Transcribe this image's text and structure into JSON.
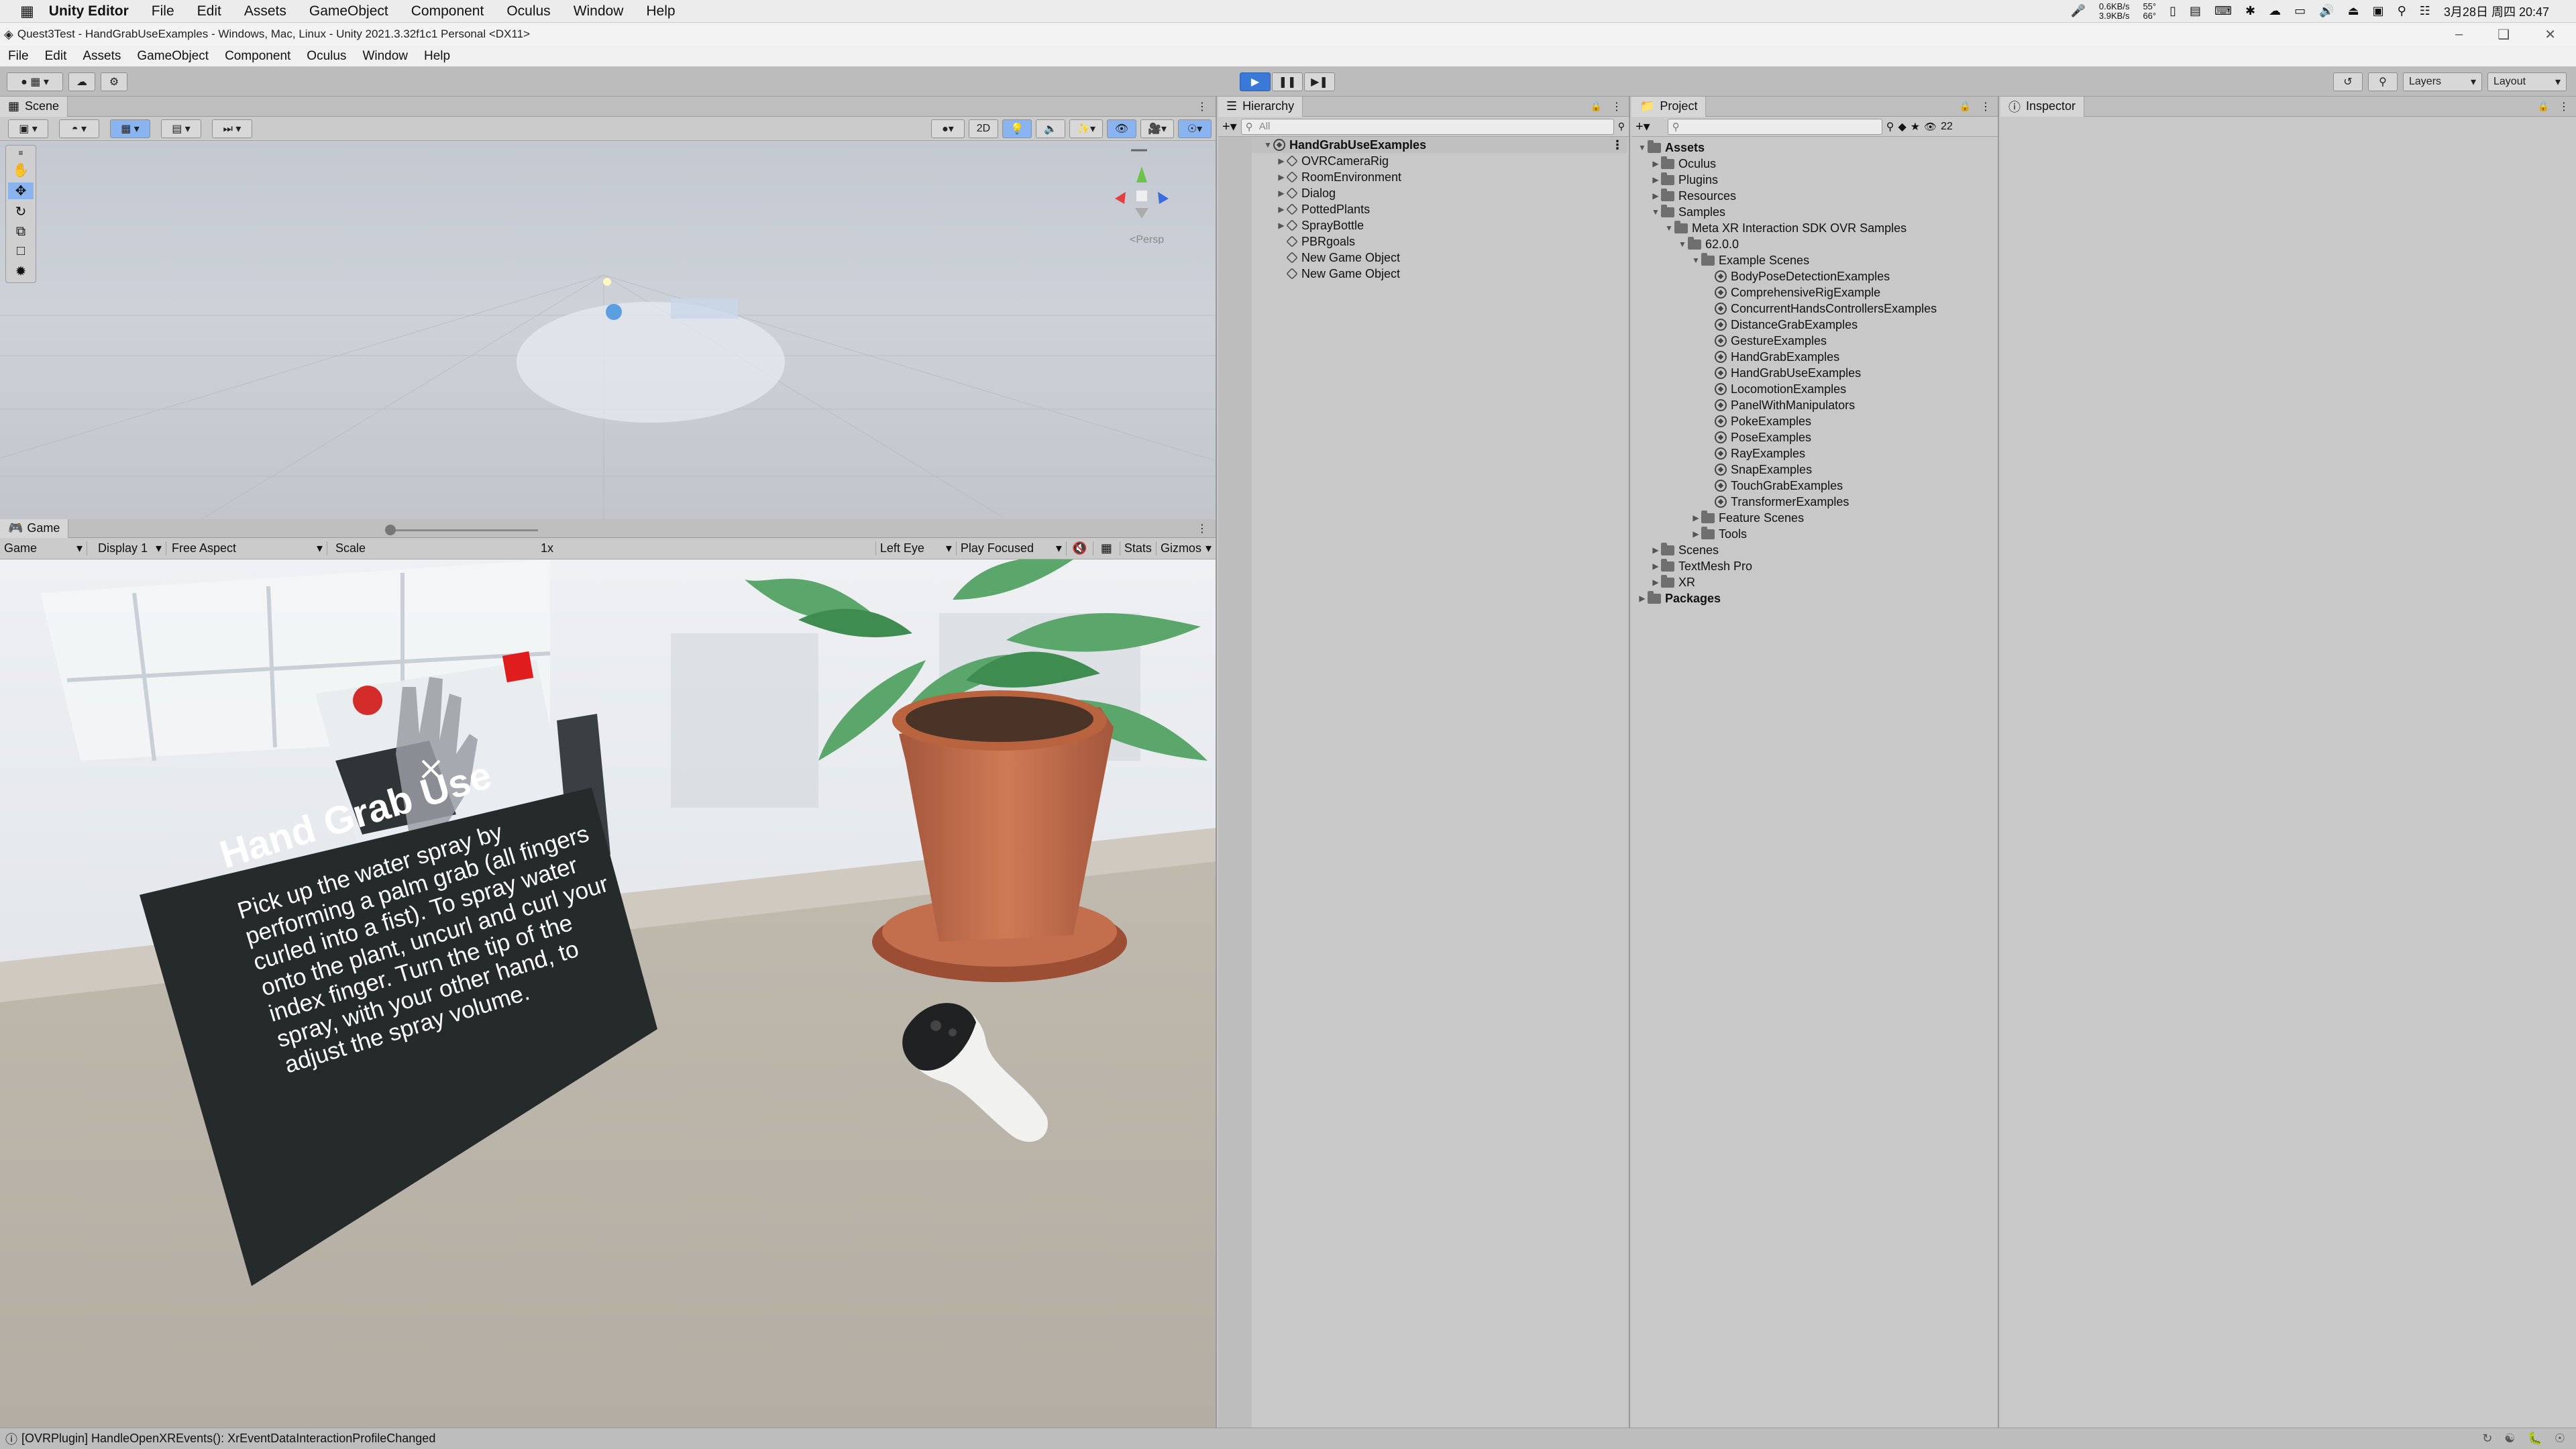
{
  "os_menu": {
    "app": "Unity Editor",
    "items": [
      "File",
      "Edit",
      "Assets",
      "GameObject",
      "Component",
      "Oculus",
      "Window",
      "Help"
    ],
    "net_up": "0.6KB/s",
    "net_down": "3.9KB/s",
    "temp1": "55°",
    "temp2": "66°",
    "clock": "3月28日 周四 20:47"
  },
  "window_title": "Quest3Test - HandGrabUseExamples - Windows, Mac, Linux - Unity 2021.3.32f1c1 Personal <DX11>",
  "menubar": [
    "File",
    "Edit",
    "Assets",
    "GameObject",
    "Component",
    "Oculus",
    "Window",
    "Help"
  ],
  "toolbar": {
    "layers_label": "Layers",
    "layout_label": "Layout"
  },
  "scene": {
    "tab": "Scene",
    "toggle_2d": "2D",
    "persp_label": "<Persp"
  },
  "game": {
    "tab": "Game",
    "view_select": "Game",
    "display_select": "Display 1",
    "aspect_select": "Free Aspect",
    "scale_label": "Scale",
    "scale_value": "1x",
    "eye_select": "Left Eye",
    "play_mode_select": "Play Focused",
    "stats_label": "Stats",
    "gizmos_label": "Gizmos",
    "panel_title": "Hand Grab Use",
    "panel_text": "Pick up the water spray by performing a palm grab (all fingers curled into a fist). To spray water onto the plant, uncurl and curl your index finger. Turn the tip of the spray, with your other hand, to adjust the spray volume."
  },
  "hierarchy": {
    "tab": "Hierarchy",
    "search_placeholder": "All",
    "root": "HandGrabUseExamples",
    "items": [
      {
        "label": "OVRCameraRig",
        "arrow": true
      },
      {
        "label": "RoomEnvironment",
        "arrow": true
      },
      {
        "label": "Dialog",
        "arrow": true
      },
      {
        "label": "PottedPlants",
        "arrow": true
      },
      {
        "label": "SprayBottle",
        "arrow": true
      },
      {
        "label": "PBRgoals",
        "arrow": false
      },
      {
        "label": "New Game Object",
        "arrow": false
      },
      {
        "label": "New Game Object",
        "arrow": false
      }
    ]
  },
  "project": {
    "tab": "Project",
    "hidden_count": "22",
    "tree": [
      {
        "label": "Assets",
        "level": 0,
        "arrow": "open",
        "icon": "folder",
        "bold": true
      },
      {
        "label": "Oculus",
        "level": 1,
        "arrow": "closed",
        "icon": "folder"
      },
      {
        "label": "Plugins",
        "level": 1,
        "arrow": "closed",
        "icon": "folder"
      },
      {
        "label": "Resources",
        "level": 1,
        "arrow": "closed",
        "icon": "folder"
      },
      {
        "label": "Samples",
        "level": 1,
        "arrow": "open",
        "icon": "folder"
      },
      {
        "label": "Meta XR Interaction SDK OVR Samples",
        "level": 2,
        "arrow": "open",
        "icon": "folder"
      },
      {
        "label": "62.0.0",
        "level": 3,
        "arrow": "open",
        "icon": "folder"
      },
      {
        "label": "Example Scenes",
        "level": 4,
        "arrow": "open",
        "icon": "folder"
      },
      {
        "label": "BodyPoseDetectionExamples",
        "level": 5,
        "arrow": "",
        "icon": "unity"
      },
      {
        "label": "ComprehensiveRigExample",
        "level": 5,
        "arrow": "",
        "icon": "unity"
      },
      {
        "label": "ConcurrentHandsControllersExamples",
        "level": 5,
        "arrow": "",
        "icon": "unity"
      },
      {
        "label": "DistanceGrabExamples",
        "level": 5,
        "arrow": "",
        "icon": "unity"
      },
      {
        "label": "GestureExamples",
        "level": 5,
        "arrow": "",
        "icon": "unity"
      },
      {
        "label": "HandGrabExamples",
        "level": 5,
        "arrow": "",
        "icon": "unity"
      },
      {
        "label": "HandGrabUseExamples",
        "level": 5,
        "arrow": "",
        "icon": "unity"
      },
      {
        "label": "LocomotionExamples",
        "level": 5,
        "arrow": "",
        "icon": "unity"
      },
      {
        "label": "PanelWithManipulators",
        "level": 5,
        "arrow": "",
        "icon": "unity"
      },
      {
        "label": "PokeExamples",
        "level": 5,
        "arrow": "",
        "icon": "unity"
      },
      {
        "label": "PoseExamples",
        "level": 5,
        "arrow": "",
        "icon": "unity"
      },
      {
        "label": "RayExamples",
        "level": 5,
        "arrow": "",
        "icon": "unity"
      },
      {
        "label": "SnapExamples",
        "level": 5,
        "arrow": "",
        "icon": "unity"
      },
      {
        "label": "TouchGrabExamples",
        "level": 5,
        "arrow": "",
        "icon": "unity"
      },
      {
        "label": "TransformerExamples",
        "level": 5,
        "arrow": "",
        "icon": "unity"
      },
      {
        "label": "Feature Scenes",
        "level": 4,
        "arrow": "closed",
        "icon": "folder"
      },
      {
        "label": "Tools",
        "level": 4,
        "arrow": "closed",
        "icon": "folder"
      },
      {
        "label": "Scenes",
        "level": 1,
        "arrow": "closed",
        "icon": "folder"
      },
      {
        "label": "TextMesh Pro",
        "level": 1,
        "arrow": "closed",
        "icon": "folder"
      },
      {
        "label": "XR",
        "level": 1,
        "arrow": "closed",
        "icon": "folder"
      },
      {
        "label": "Packages",
        "level": 0,
        "arrow": "closed",
        "icon": "folder",
        "bold": true
      }
    ]
  },
  "inspector": {
    "tab": "Inspector"
  },
  "status": {
    "message": "[OVRPlugin] HandleOpenXREvents(): XrEventDataInteractionProfileChanged"
  },
  "colors": {
    "play_active": "#3a79d8",
    "accent_selected": "#8ab4f0",
    "panel_bg": "#c8c8c8"
  }
}
